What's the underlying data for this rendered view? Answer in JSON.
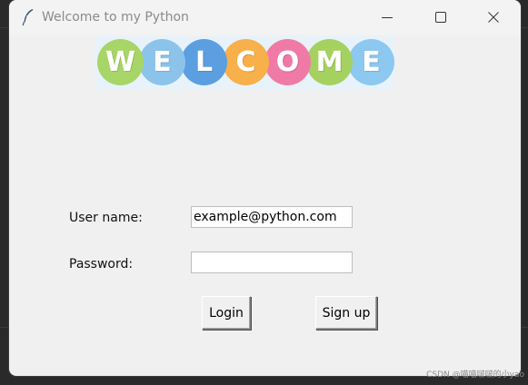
{
  "window": {
    "title": "Welcome to my Python",
    "controls": {
      "minimize": "minimize-icon",
      "maximize": "maximize-icon",
      "close": "close-icon"
    }
  },
  "banner": {
    "letters": [
      {
        "char": "W",
        "color": "#a8d567"
      },
      {
        "char": "E",
        "color": "#8cc3ea"
      },
      {
        "char": "L",
        "color": "#5b9fe0"
      },
      {
        "char": "C",
        "color": "#f7b04a"
      },
      {
        "char": "O",
        "color": "#ef7aa6"
      },
      {
        "char": "M",
        "color": "#a5d160"
      },
      {
        "char": "E",
        "color": "#8cc8f0"
      }
    ]
  },
  "form": {
    "username_label": "User name:",
    "username_value": "example@python.com",
    "password_label": "Password:",
    "password_value": "",
    "login_label": "Login",
    "signup_label": "Sign up"
  },
  "watermark": "CSDN @喵喵啵啵的小yao"
}
